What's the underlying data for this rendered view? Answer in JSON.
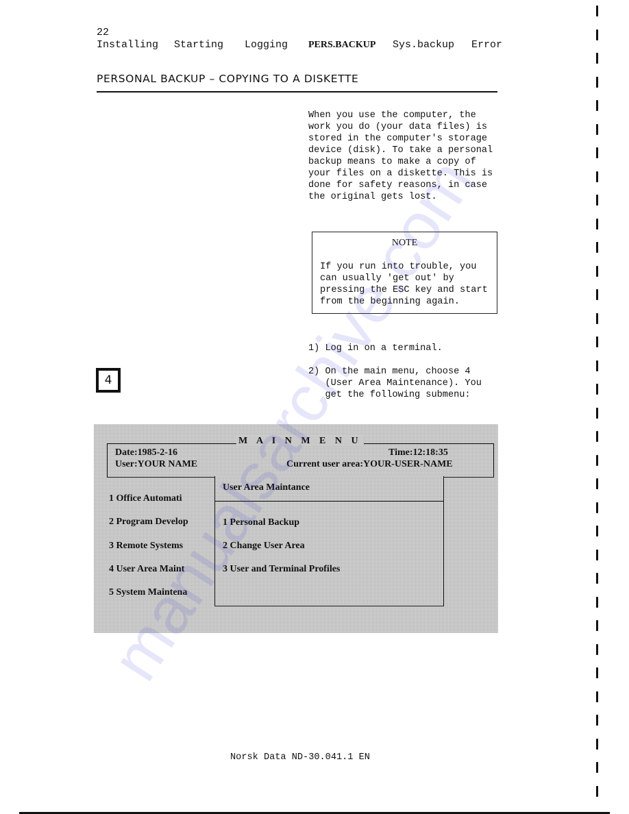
{
  "header": {
    "page_number": "22",
    "nav_tabs": [
      {
        "label": "Installing",
        "active": false
      },
      {
        "label": "Starting",
        "active": false
      },
      {
        "label": "Logging",
        "active": false
      },
      {
        "label": "PERS.BACKUP",
        "active": true
      },
      {
        "label": "Sys.backup",
        "active": false
      },
      {
        "label": "Error",
        "active": false
      }
    ]
  },
  "section": {
    "title": "PERSONAL BACKUP – COPYING TO A DISKETTE"
  },
  "intro": {
    "text": "When you use the computer, the\nwork you do (your data files) is\nstored in the computer's storage\ndevice (disk). To take a personal\nbackup means to make a copy of\nyour files on a diskette. This is\ndone for safety reasons, in case\nthe original gets lost."
  },
  "note": {
    "title": "NOTE",
    "text": "If you run into trouble, you\ncan usually 'get out' by\npressing the ESC key and start\nfrom the beginning again."
  },
  "steps": [
    {
      "text": "1) Log in on a terminal."
    },
    {
      "text": "2) On the main menu, choose 4\n   (User Area Maintenance). You\n   get the following submenu:"
    }
  ],
  "chapter_marker": "4",
  "terminal": {
    "title": "M A I N  M E N U",
    "date": "Date:1985-2-16",
    "time": "Time:12:18:35",
    "user": "User:YOUR NAME",
    "current_area": "Current user area:YOUR-USER-NAME",
    "main_items": [
      "1 Office Automati",
      "2 Program Develop",
      "3 Remote Systems",
      "4 User Area Maint",
      "5 System Maintena"
    ],
    "submenu": {
      "title": "User Area Maintance",
      "items": [
        "1 Personal Backup",
        "2 Change User Area",
        "3 User and Terminal Profiles"
      ]
    }
  },
  "footer": {
    "text": "Norsk Data ND-30.041.1 EN"
  },
  "watermark": {
    "text": "manualsarchive.com",
    "color": "#3b3bd9"
  }
}
